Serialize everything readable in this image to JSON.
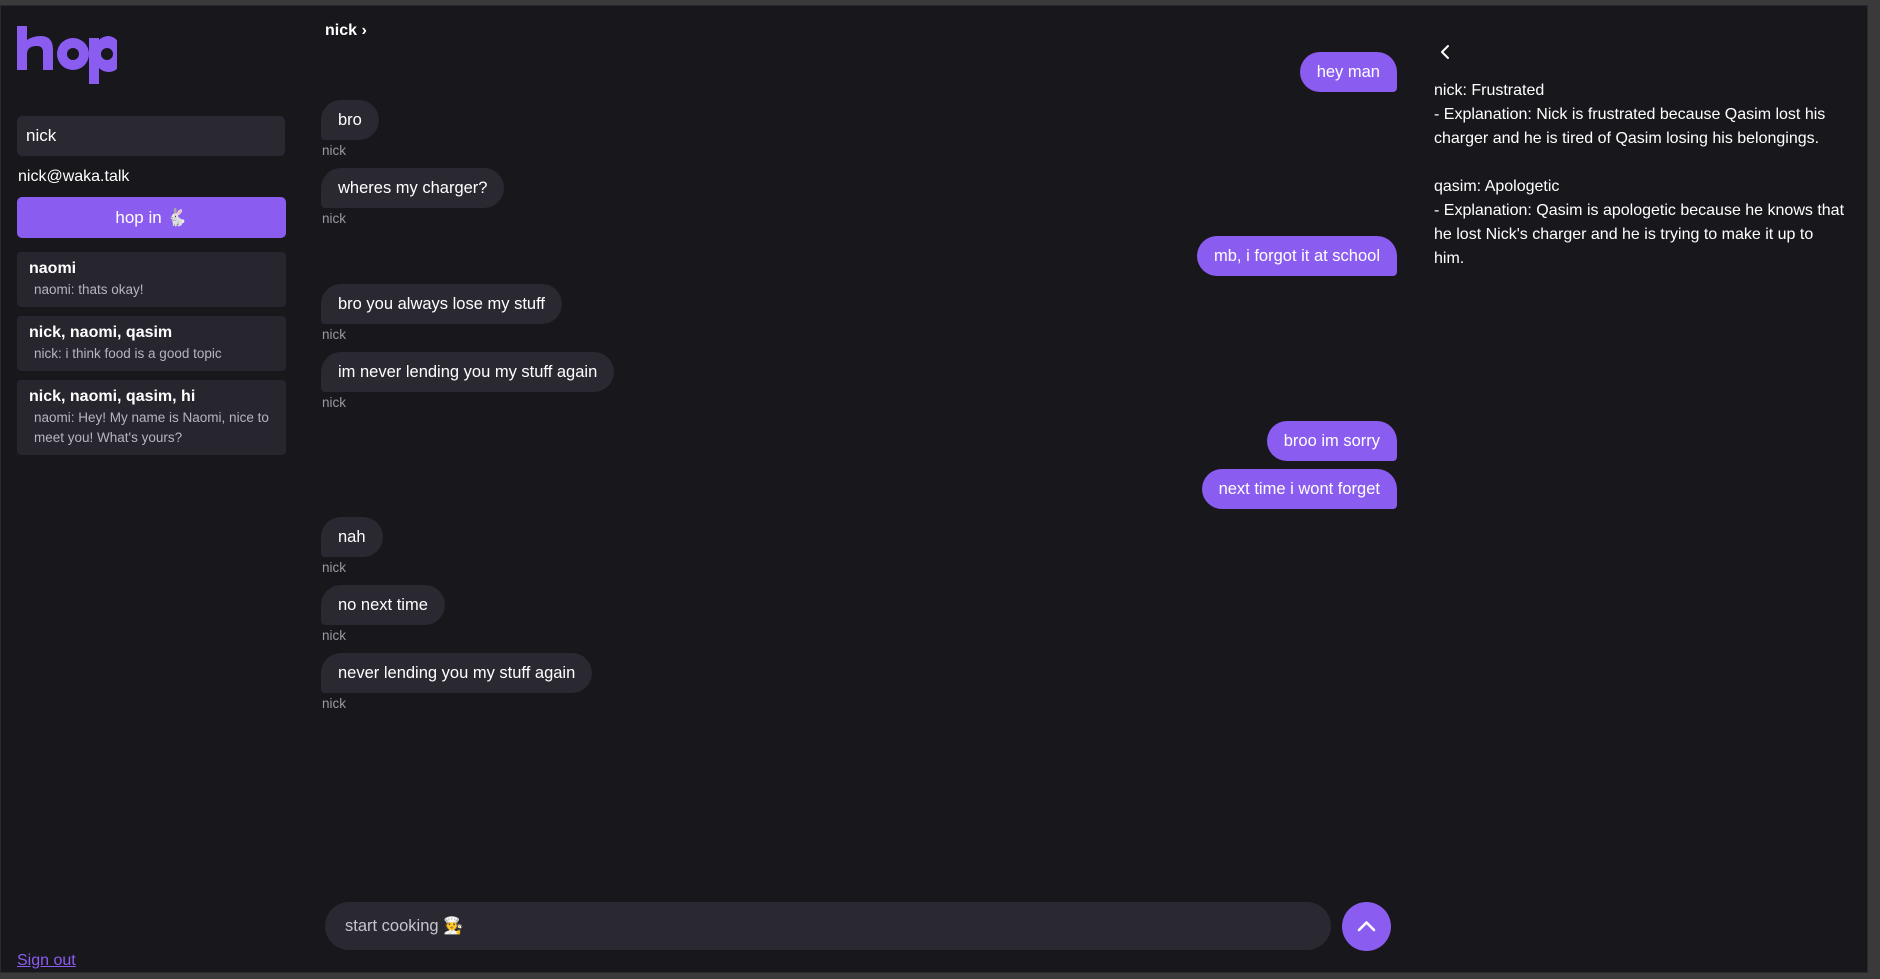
{
  "sidebar": {
    "logo_text": "hop",
    "search_value": "nick",
    "email": "nick@waka.talk",
    "hop_button_label": "hop in 🐇",
    "chats": [
      {
        "name": "naomi",
        "preview": "naomi: thats okay!"
      },
      {
        "name": "nick, naomi, qasim",
        "preview": "nick: i think food is a good topic"
      },
      {
        "name": "nick, naomi, qasim, hi",
        "preview": "naomi: Hey! My name is Naomi, nice to meet you! What's yours?"
      }
    ],
    "sign_out_label": "Sign out"
  },
  "chat": {
    "header": "nick ›",
    "messages": [
      {
        "dir": "out",
        "text": "hey man"
      },
      {
        "dir": "in",
        "text": "bro",
        "sender": "nick"
      },
      {
        "dir": "in",
        "text": "wheres my charger?",
        "sender": "nick"
      },
      {
        "dir": "out",
        "text": "mb, i forgot it at school"
      },
      {
        "dir": "in",
        "text": "bro you always lose my stuff",
        "sender": "nick"
      },
      {
        "dir": "in",
        "text": "im never lending you my stuff again",
        "sender": "nick"
      },
      {
        "dir": "out",
        "text": "broo im sorry"
      },
      {
        "dir": "out",
        "text": "next time i wont forget"
      },
      {
        "dir": "in",
        "text": "nah",
        "sender": "nick"
      },
      {
        "dir": "in",
        "text": "no next time",
        "sender": "nick"
      },
      {
        "dir": "in",
        "text": "never lending you my stuff again",
        "sender": "nick"
      }
    ],
    "composer_placeholder": "start cooking 🧑‍🍳"
  },
  "panel": {
    "nick_title": "nick: Frustrated",
    "nick_explanation": "- Explanation: Nick is frustrated because Qasim lost his charger and he is tired of Qasim losing his belongings.",
    "qasim_title": "qasim: Apologetic",
    "qasim_explanation": "- Explanation: Qasim is apologetic because he knows that he lost Nick's charger and he is trying to make it up to him."
  },
  "colors": {
    "accent": "#8b5cf0",
    "background": "#18171c",
    "surface": "#2a2831"
  }
}
